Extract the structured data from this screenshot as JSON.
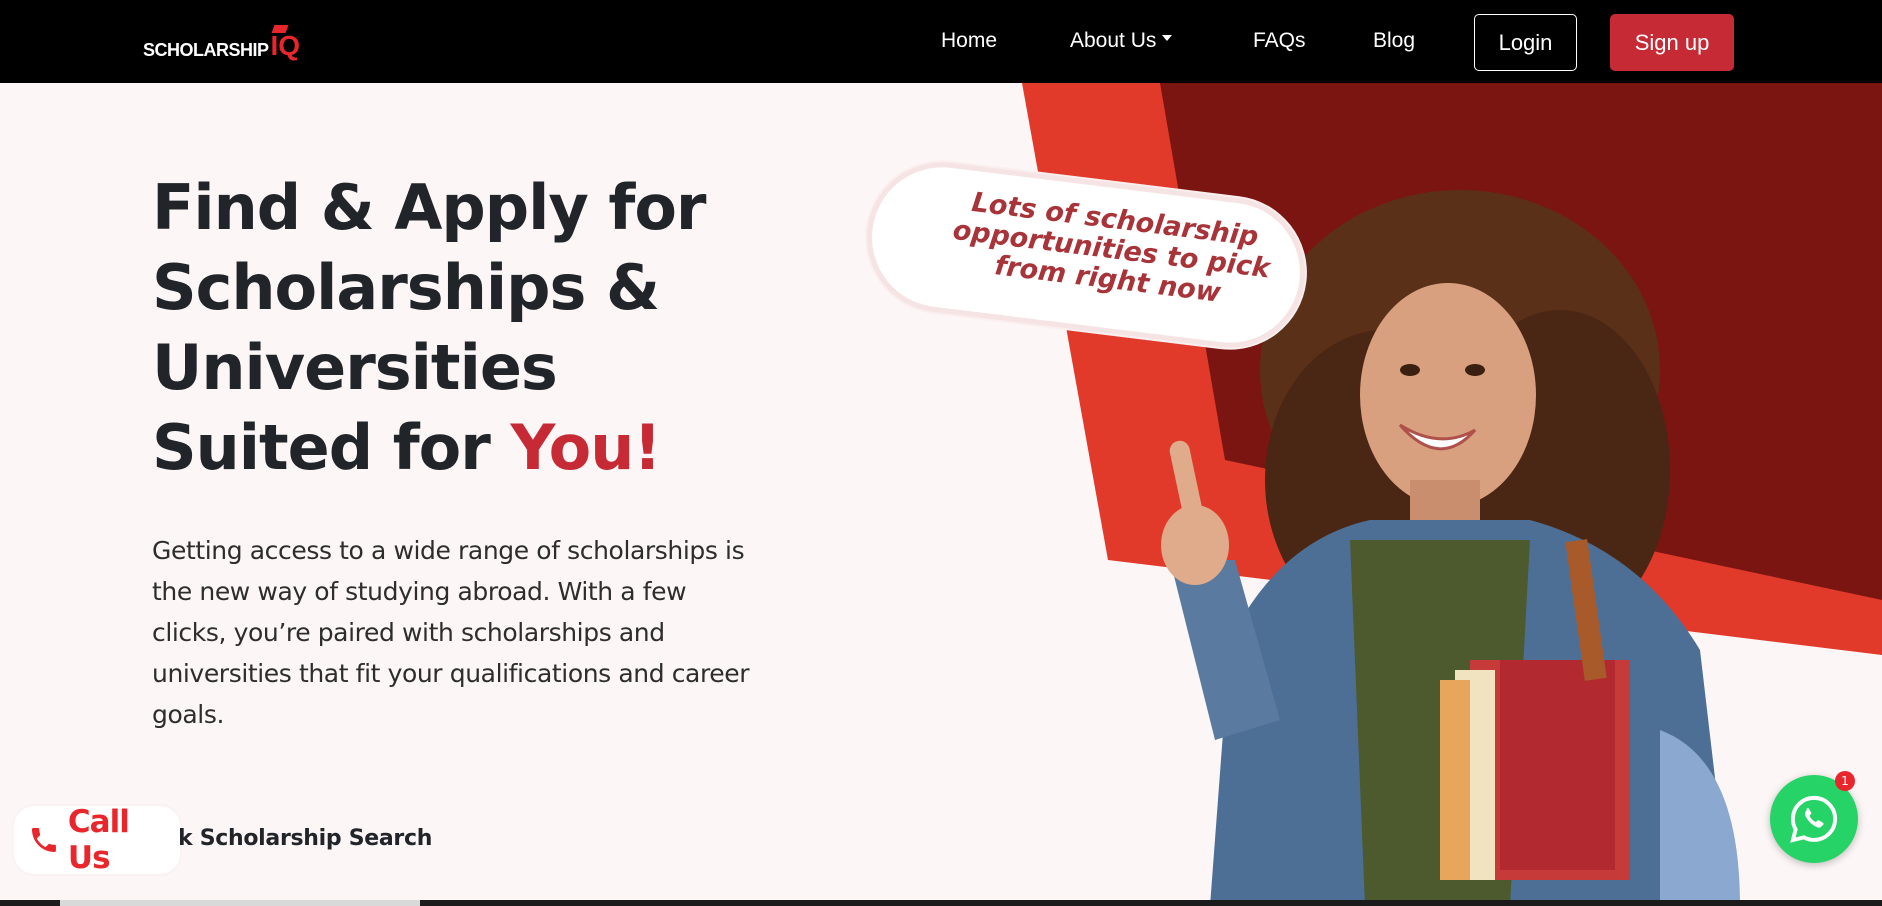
{
  "brand": {
    "text": "SCHOLARSHIP",
    "suffix": "IQ"
  },
  "nav": {
    "home": "Home",
    "about": "About Us",
    "faqs": "FAQs",
    "blog": "Blog",
    "login": "Login",
    "signup": "Sign up"
  },
  "hero": {
    "title_prefix": "Find & Apply for Scholarships & Universities Suited for ",
    "title_accent": "You!",
    "description": "Getting access to a wide range of scholarships is the new way of studying abroad. With a few clicks, you’re paired with scholarships and universities that fit your qualifications and career goals.",
    "bubble": "Lots of scholarship opportunities to pick from right now",
    "quick_search_partial": "k Scholarship Search"
  },
  "call_us": {
    "label": "Call Us",
    "icon": "phone-icon"
  },
  "whatsapp": {
    "icon": "whatsapp-icon",
    "badge": "1"
  },
  "colors": {
    "navbar": "#000000",
    "accent": "#c62b35",
    "red_bright": "#e8262b",
    "red_dark": "#7b1512",
    "background": "#fdf6f6",
    "whatsapp": "#25d366"
  }
}
